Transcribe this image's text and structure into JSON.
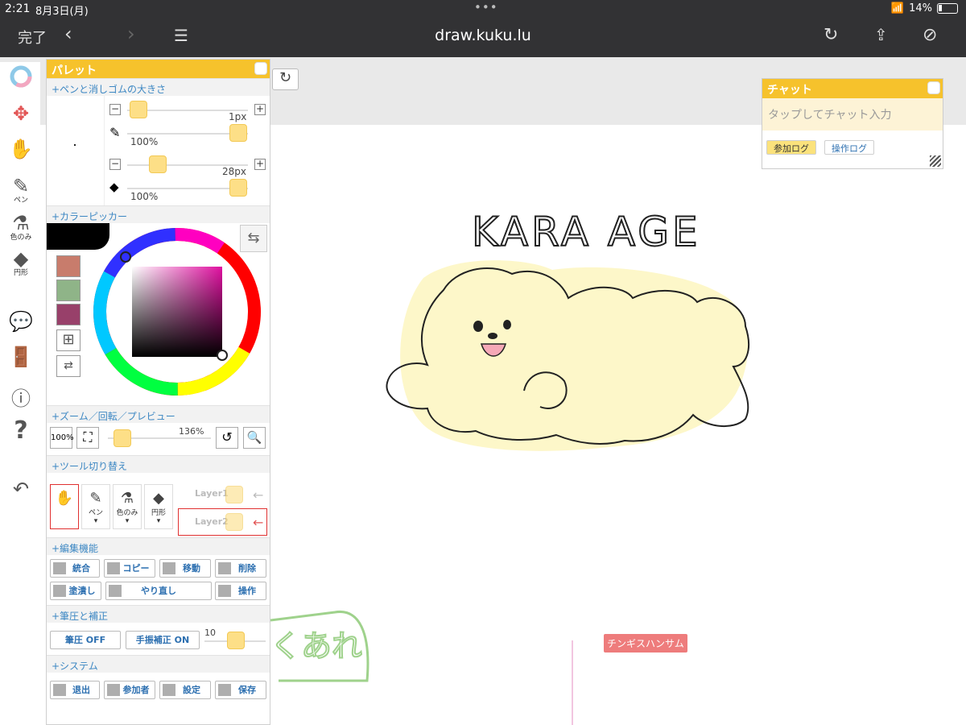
{
  "status": {
    "time": "2:21",
    "date": "8月3日(月)",
    "battery": "14%"
  },
  "browser": {
    "done": "完了",
    "url": "draw.kuku.lu"
  },
  "toolbar": {
    "pen": "ペン",
    "color_only": "色のみ",
    "circle": "円形"
  },
  "palette": {
    "title": "パレット",
    "sec_size": "+ペンと消しゴムの大きさ",
    "pen_size": "1px",
    "pen_opacity": "100%",
    "eraser_size": "28px",
    "eraser_opacity": "100%",
    "sec_color": "+カラーピッカー",
    "sec_zoom": "+ズーム／回転／プレビュー",
    "zoom_btn": "100%",
    "zoom_value": "136%",
    "sec_tools": "+ツール切り替え",
    "tools": [
      "ペン",
      "色のみ",
      "円形"
    ],
    "layers": [
      "Layer1",
      "Layer2"
    ],
    "sec_edit": "+編集機能",
    "edit": {
      "merge": "統合",
      "copy": "コピー",
      "move": "移動",
      "delete": "削除",
      "fill": "塗潰し",
      "redo": "やり直し",
      "ops": "操作"
    },
    "sec_pressure": "+筆圧と補正",
    "pressure": {
      "pressure_off": "筆圧 OFF",
      "correction_on": "手振補正 ON",
      "value": "10"
    },
    "sec_system": "+システム",
    "system": {
      "exit": "退出",
      "members": "参加者",
      "settings": "設定",
      "save": "保存"
    }
  },
  "chat": {
    "title": "チャット",
    "placeholder": "タップしてチャット入力",
    "tab_join": "参加ログ",
    "tab_ops": "操作ログ"
  },
  "canvas": {
    "title_text": "KARA AGE",
    "user_tag": "チンギスハンサム",
    "scribble": "くあれ"
  },
  "colors": {
    "accent": "#f6c22c",
    "swatch1": "#c87c6c",
    "swatch2": "#8fb488",
    "swatch3": "#98406a"
  }
}
